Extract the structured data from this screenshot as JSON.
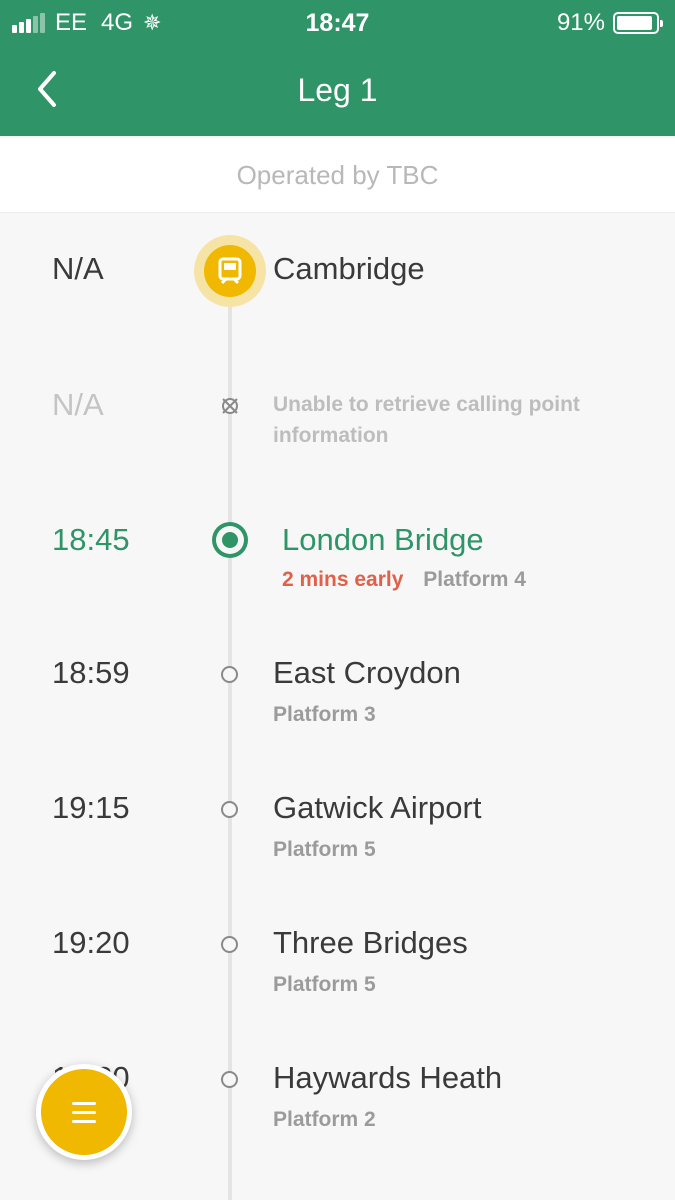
{
  "status_bar": {
    "carrier": "EE",
    "network": "4G",
    "time": "18:47",
    "battery": "91%",
    "battery_level": 0.91
  },
  "header": {
    "title": "Leg 1",
    "back_icon": "chevron-left-icon"
  },
  "operator_text": "Operated by TBC",
  "colors": {
    "brand_green": "#2f9467",
    "accent_yellow": "#f0b800",
    "early_red": "#e0604a"
  },
  "stops": [
    {
      "time": "N/A",
      "name": "Cambridge",
      "state": "origin"
    },
    {
      "time": "N/A",
      "name": "Unable to retrieve calling point information",
      "state": "unavailable"
    },
    {
      "time": "18:45",
      "name": "London Bridge",
      "early": "2 mins early",
      "platform": "Platform 4",
      "state": "current"
    },
    {
      "time": "18:59",
      "name": "East Croydon",
      "platform": "Platform 3",
      "state": "upcoming"
    },
    {
      "time": "19:15",
      "name": "Gatwick Airport",
      "platform": "Platform 5",
      "state": "upcoming"
    },
    {
      "time": "19:20",
      "name": "Three Bridges",
      "platform": "Platform 5",
      "state": "upcoming"
    },
    {
      "time": "19:30",
      "name": "Haywards Heath",
      "platform": "Platform 2",
      "state": "upcoming"
    }
  ],
  "menu_button_icon": "hamburger-menu-icon"
}
